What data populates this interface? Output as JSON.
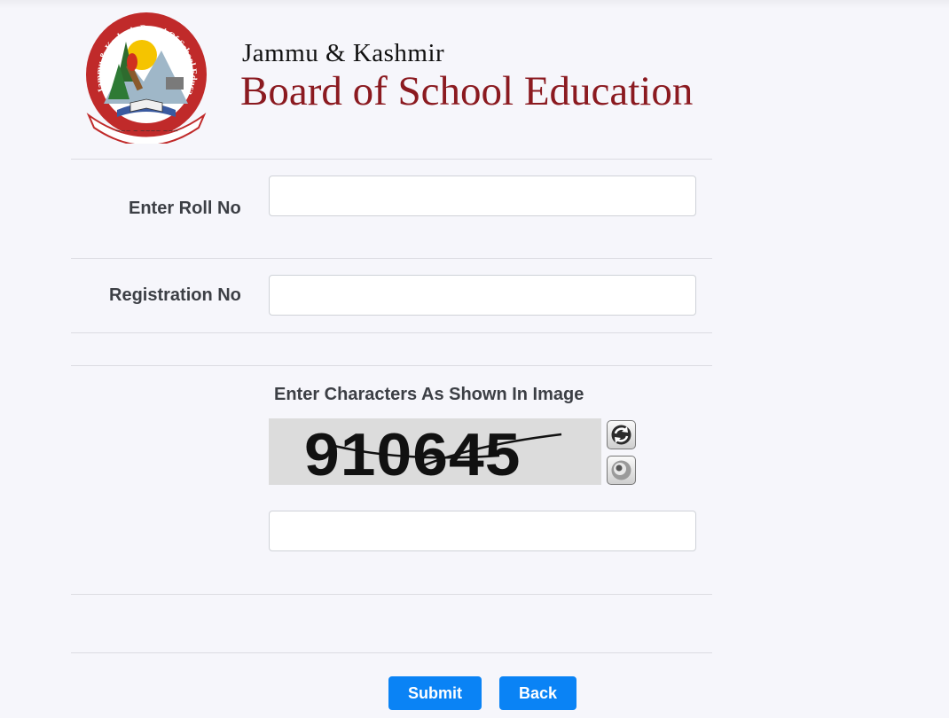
{
  "header": {
    "logo_name": "jkbose-logo",
    "logo_ring_text": "Jammu & Kashmir Board Of School Education",
    "org_line1": "Jammu & Kashmir",
    "org_line2": "Board of School Education"
  },
  "form": {
    "roll_label": "Enter Roll No",
    "roll_value": "",
    "registration_label": "Registration No",
    "registration_value": "",
    "captcha_label": "Enter Characters As Shown In Image",
    "captcha_text": "910645",
    "captcha_refresh_icon": "refresh-icon",
    "captcha_audio_icon": "audio-icon",
    "captcha_value": ""
  },
  "buttons": {
    "submit_label": "Submit",
    "back_label": "Back"
  },
  "colors": {
    "brand_maroon": "#8b1a20",
    "button_blue": "#0a83f5",
    "background": "#f6f6fb"
  }
}
